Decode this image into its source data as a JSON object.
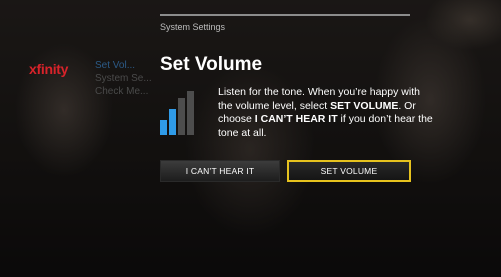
{
  "header": {
    "breadcrumb": "System Settings"
  },
  "brand": {
    "logo_text": "xfinity",
    "color": "#d8232a"
  },
  "side_menu": {
    "items": [
      {
        "label": "Set Vol..."
      },
      {
        "label": "System Se..."
      },
      {
        "label": "Check Me..."
      }
    ]
  },
  "dialog": {
    "title": "Set Volume",
    "message": {
      "p1": "Listen for the tone. When you’re happy with the volume level, select ",
      "b1": "SET VOLUME",
      "p2": ". Or choose ",
      "b2": "I CAN’T HEAR IT",
      "p3": " if you don’t hear the tone at all."
    },
    "buttons": {
      "cant_hear_label": "I CAN’T HEAR IT",
      "set_volume_label": "SET VOLUME",
      "focused": "SET VOLUME"
    },
    "volume_icon": {
      "level_bars": [
        0.35,
        0.6,
        0.85,
        1.0
      ],
      "active_bars": 2,
      "active_color": "#2f9be8",
      "inactive_color": "#4d4d4d"
    }
  },
  "colors": {
    "focus_border": "#e6c21e"
  }
}
